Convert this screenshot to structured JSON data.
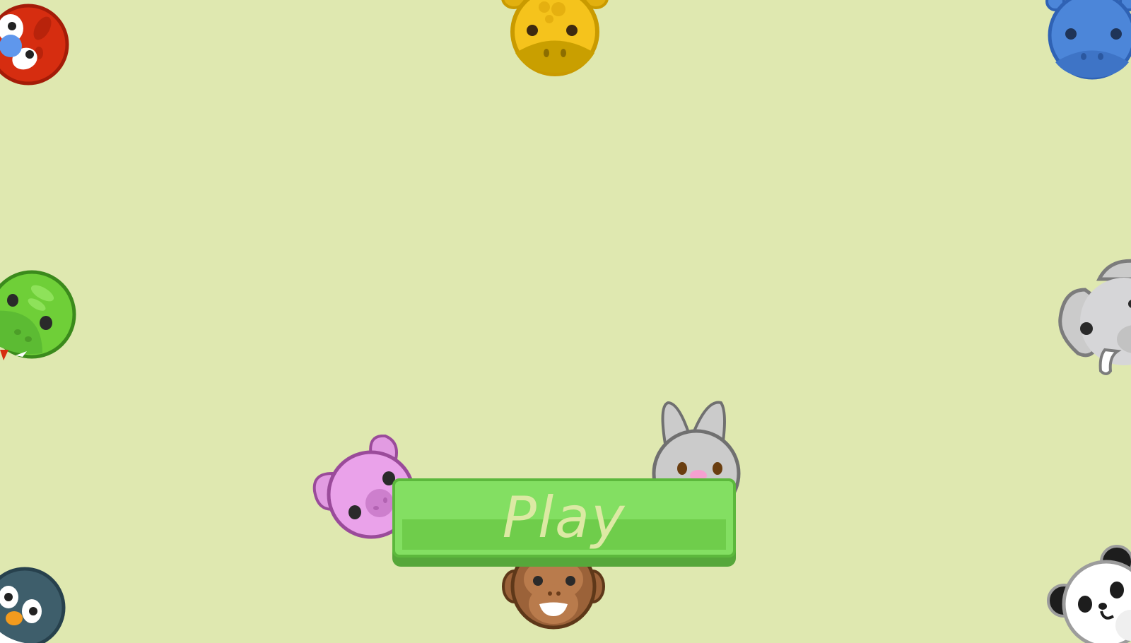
{
  "play_button": {
    "label": "Play"
  },
  "animals": [
    {
      "name": "parrot",
      "icon": "parrot-icon",
      "color": "#d62d10"
    },
    {
      "name": "giraffe",
      "icon": "giraffe-icon",
      "color": "#f5c31c"
    },
    {
      "name": "hippo",
      "icon": "hippo-icon",
      "color": "#4c86d9"
    },
    {
      "name": "crocodile",
      "icon": "crocodile-icon",
      "color": "#6fcf38"
    },
    {
      "name": "elephant",
      "icon": "elephant-icon",
      "color": "#c9c9cb"
    },
    {
      "name": "pig",
      "icon": "pig-icon",
      "color": "#eaa2ea"
    },
    {
      "name": "rabbit",
      "icon": "rabbit-icon",
      "color": "#cbcbcb"
    },
    {
      "name": "monkey",
      "icon": "monkey-icon",
      "color": "#9b6239"
    },
    {
      "name": "penguin",
      "icon": "penguin-icon",
      "color": "#3e5e6b"
    },
    {
      "name": "panda",
      "icon": "panda-icon",
      "color": "#ffffff"
    }
  ],
  "colors": {
    "background": "#dfe8b0",
    "button": "#83df62",
    "button_text": "#dce9a4"
  }
}
